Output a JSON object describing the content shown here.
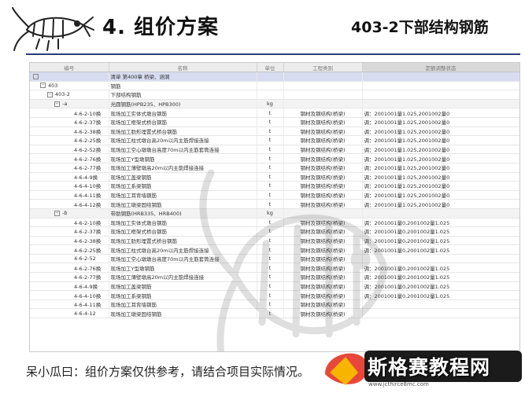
{
  "header": {
    "section_title": "4. 组价方案",
    "right_title": "403-2下部结构钢筋"
  },
  "table": {
    "columns": [
      "编号",
      "名称",
      "单位",
      "工程类别",
      "定额调整状态"
    ],
    "rows": [
      {
        "code": "",
        "name": "清单 第400章 桥梁、涵洞",
        "unit": "",
        "cat": "",
        "adj": "",
        "level": 0,
        "sel": true
      },
      {
        "code": "403",
        "name": "钢筋",
        "unit": "",
        "cat": "",
        "adj": "",
        "level": 1
      },
      {
        "code": "403-2",
        "name": "下部结构钢筋",
        "unit": "",
        "cat": "",
        "adj": "",
        "level": 2
      },
      {
        "code": "-a",
        "name": "光圆钢筋(HPB235、HPB300)",
        "unit": "kg",
        "cat": "",
        "adj": "",
        "level": 3,
        "group": true
      },
      {
        "code": "4-6-2-10换",
        "name": "现场加工实体式墩台钢筋",
        "unit": "t",
        "cat": "钢材及钢结构(桥梁)",
        "adj": "调：2001001量1.025,2001002量0"
      },
      {
        "code": "4-6-2-37换",
        "name": "现场加工框架式桥台钢筋",
        "unit": "t",
        "cat": "钢材及钢结构(桥梁)",
        "adj": "调：2001001量1.025,2001002量0"
      },
      {
        "code": "4-6-2-38换",
        "name": "现场加工肋形埋置式桥台钢筋",
        "unit": "t",
        "cat": "钢材及钢结构(桥梁)",
        "adj": "调：2001001量1.025,2001002量0"
      },
      {
        "code": "4-6-2-25换",
        "name": "现场加工柱式墩台高20m以内主筋焊接连接",
        "unit": "t",
        "cat": "钢材及钢结构(桥梁)",
        "adj": "调：2001001量1.025,2001002量0"
      },
      {
        "code": "4-6-2-52换",
        "name": "现场加工空心墩墩台高度70m以内主筋套筒连接",
        "unit": "t",
        "cat": "钢材及钢结构(桥梁)",
        "adj": "调：2001001量1.025,2001002量0"
      },
      {
        "code": "4-6-2-76换",
        "name": "现场加工Y型墩钢筋",
        "unit": "t",
        "cat": "钢材及钢结构(桥梁)",
        "adj": "调：2001001量1.025,2001002量0"
      },
      {
        "code": "4-6-2-77换",
        "name": "现场加工薄壁墩高20m以内主筋焊接连接",
        "unit": "t",
        "cat": "钢材及钢结构(桥梁)",
        "adj": "调：2001001量1.025,2001002量0"
      },
      {
        "code": "4-6-4-9换",
        "name": "现场加工盖梁钢筋",
        "unit": "t",
        "cat": "钢材及钢结构(桥梁)",
        "adj": "调：2001001量1.025,2001002量0"
      },
      {
        "code": "4-6-4-10换",
        "name": "现场加工系梁钢筋",
        "unit": "t",
        "cat": "钢材及钢结构(桥梁)",
        "adj": "调：2001001量1.025,2001002量0"
      },
      {
        "code": "4-6-4-11换",
        "name": "现场加工耳背墙钢筋",
        "unit": "t",
        "cat": "钢材及钢结构(桥梁)",
        "adj": "调：2001001量1.025,2001002量0"
      },
      {
        "code": "4-6-4-12换",
        "name": "现场加工墩梁固结钢筋",
        "unit": "t",
        "cat": "钢材及钢结构(桥梁)",
        "adj": "调：2001001量1.025,2001002量0"
      },
      {
        "code": "-b",
        "name": "带肋钢筋(HRB335、HRB400)",
        "unit": "kg",
        "cat": "",
        "adj": "",
        "level": 3,
        "group": true
      },
      {
        "code": "4-6-2-10换",
        "name": "现场加工实体式墩台钢筋",
        "unit": "t",
        "cat": "钢材及钢结构(桥梁)",
        "adj": "调：2001001量0,2001002量1.025"
      },
      {
        "code": "4-6-2-37换",
        "name": "现场加工框架式桥台钢筋",
        "unit": "t",
        "cat": "钢材及钢结构(桥梁)",
        "adj": "调：2001001量0,2001002量1.025"
      },
      {
        "code": "4-6-2-38换",
        "name": "现场加工肋形埋置式桥台钢筋",
        "unit": "t",
        "cat": "钢材及钢结构(桥梁)",
        "adj": "调：2001001量0,2001002量1.025"
      },
      {
        "code": "4-6-2-25换",
        "name": "现场加工柱式墩台高20m以内主筋焊接连接",
        "unit": "t",
        "cat": "钢材及钢结构(桥梁)",
        "adj": "调：2001001量0,2001002量1.025"
      },
      {
        "code": "4-6-2-52",
        "name": "现场加工空心墩墩台高度70m以内主筋套筒连接",
        "unit": "t",
        "cat": "钢材及钢结构(桥梁)",
        "adj": ""
      },
      {
        "code": "4-6-2-76换",
        "name": "现场加工Y型墩钢筋",
        "unit": "t",
        "cat": "钢材及钢结构(桥梁)",
        "adj": "调：2001001量0,2001002量1.025"
      },
      {
        "code": "4-6-2-77换",
        "name": "现场加工薄壁墩高20m以内主筋焊接连接",
        "unit": "t",
        "cat": "钢材及钢结构(桥梁)",
        "adj": "调：2001001量0,2001002量1.025"
      },
      {
        "code": "4-6-4-9换",
        "name": "现场加工盖梁钢筋",
        "unit": "t",
        "cat": "钢材及钢结构(桥梁)",
        "adj": "调：2001001量0,2001002量1.025"
      },
      {
        "code": "4-6-4-10换",
        "name": "现场加工系梁钢筋",
        "unit": "t",
        "cat": "钢材及钢结构(桥梁)",
        "adj": "调：2001001量0,2001002量1.025"
      },
      {
        "code": "4-6-4-11换",
        "name": "现场加工耳背墙钢筋",
        "unit": "t",
        "cat": "钢材及钢结构(桥梁)",
        "adj": ""
      },
      {
        "code": "4-6-4-12",
        "name": "现场加工墩梁固结钢筋",
        "unit": "t",
        "cat": "钢材及钢结构(桥梁)",
        "adj": ""
      }
    ]
  },
  "footer": {
    "text": "呆小瓜曰：组价方案仅供参考，请结合项目实际情况。"
  },
  "badge": {
    "text": "斯格赛教程网",
    "url": "www.jcthirce8mc.com"
  },
  "colors": {
    "rule": "#2c3e73",
    "selected_row": "#d7dcf1"
  }
}
